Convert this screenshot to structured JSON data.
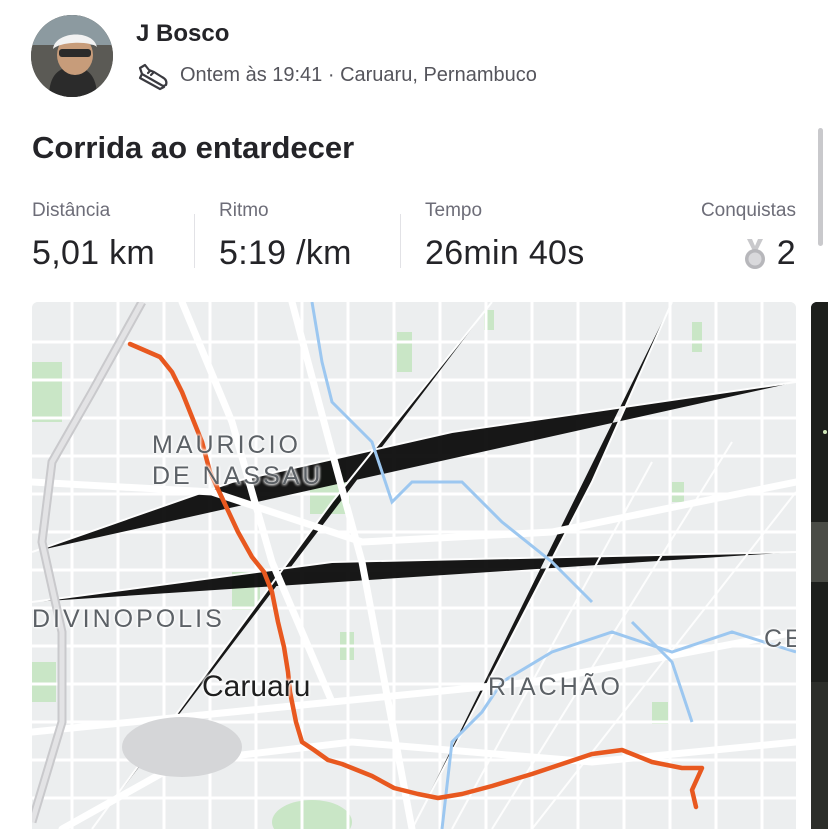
{
  "author": {
    "name": "J Bosco"
  },
  "activity": {
    "sport_icon": "running-shoe-icon",
    "meta": "Ontem às 19:41 · Caruaru, Pernambuco",
    "title": "Corrida ao entardecer"
  },
  "stats": {
    "distance": {
      "label": "Distância",
      "value": "5,01 km"
    },
    "pace": {
      "label": "Ritmo",
      "value": "5:19 /km"
    },
    "time": {
      "label": "Tempo",
      "value": "26min 40s"
    },
    "achievements": {
      "label": "Conquistas",
      "value": "2",
      "icon": "medal-icon"
    }
  },
  "map": {
    "labels": {
      "mauricio": "MAURICIO\nDE NASSAU",
      "divinopolis": "DIVINOPOLIS",
      "city": "Caruaru",
      "riachao": "RIACHÃO",
      "ce": "CE"
    },
    "colors": {
      "route": "#e8581f",
      "road": "#ffffff",
      "park": "#c9e6c6",
      "water": "#9cc7f0",
      "background": "#eceeef"
    }
  }
}
